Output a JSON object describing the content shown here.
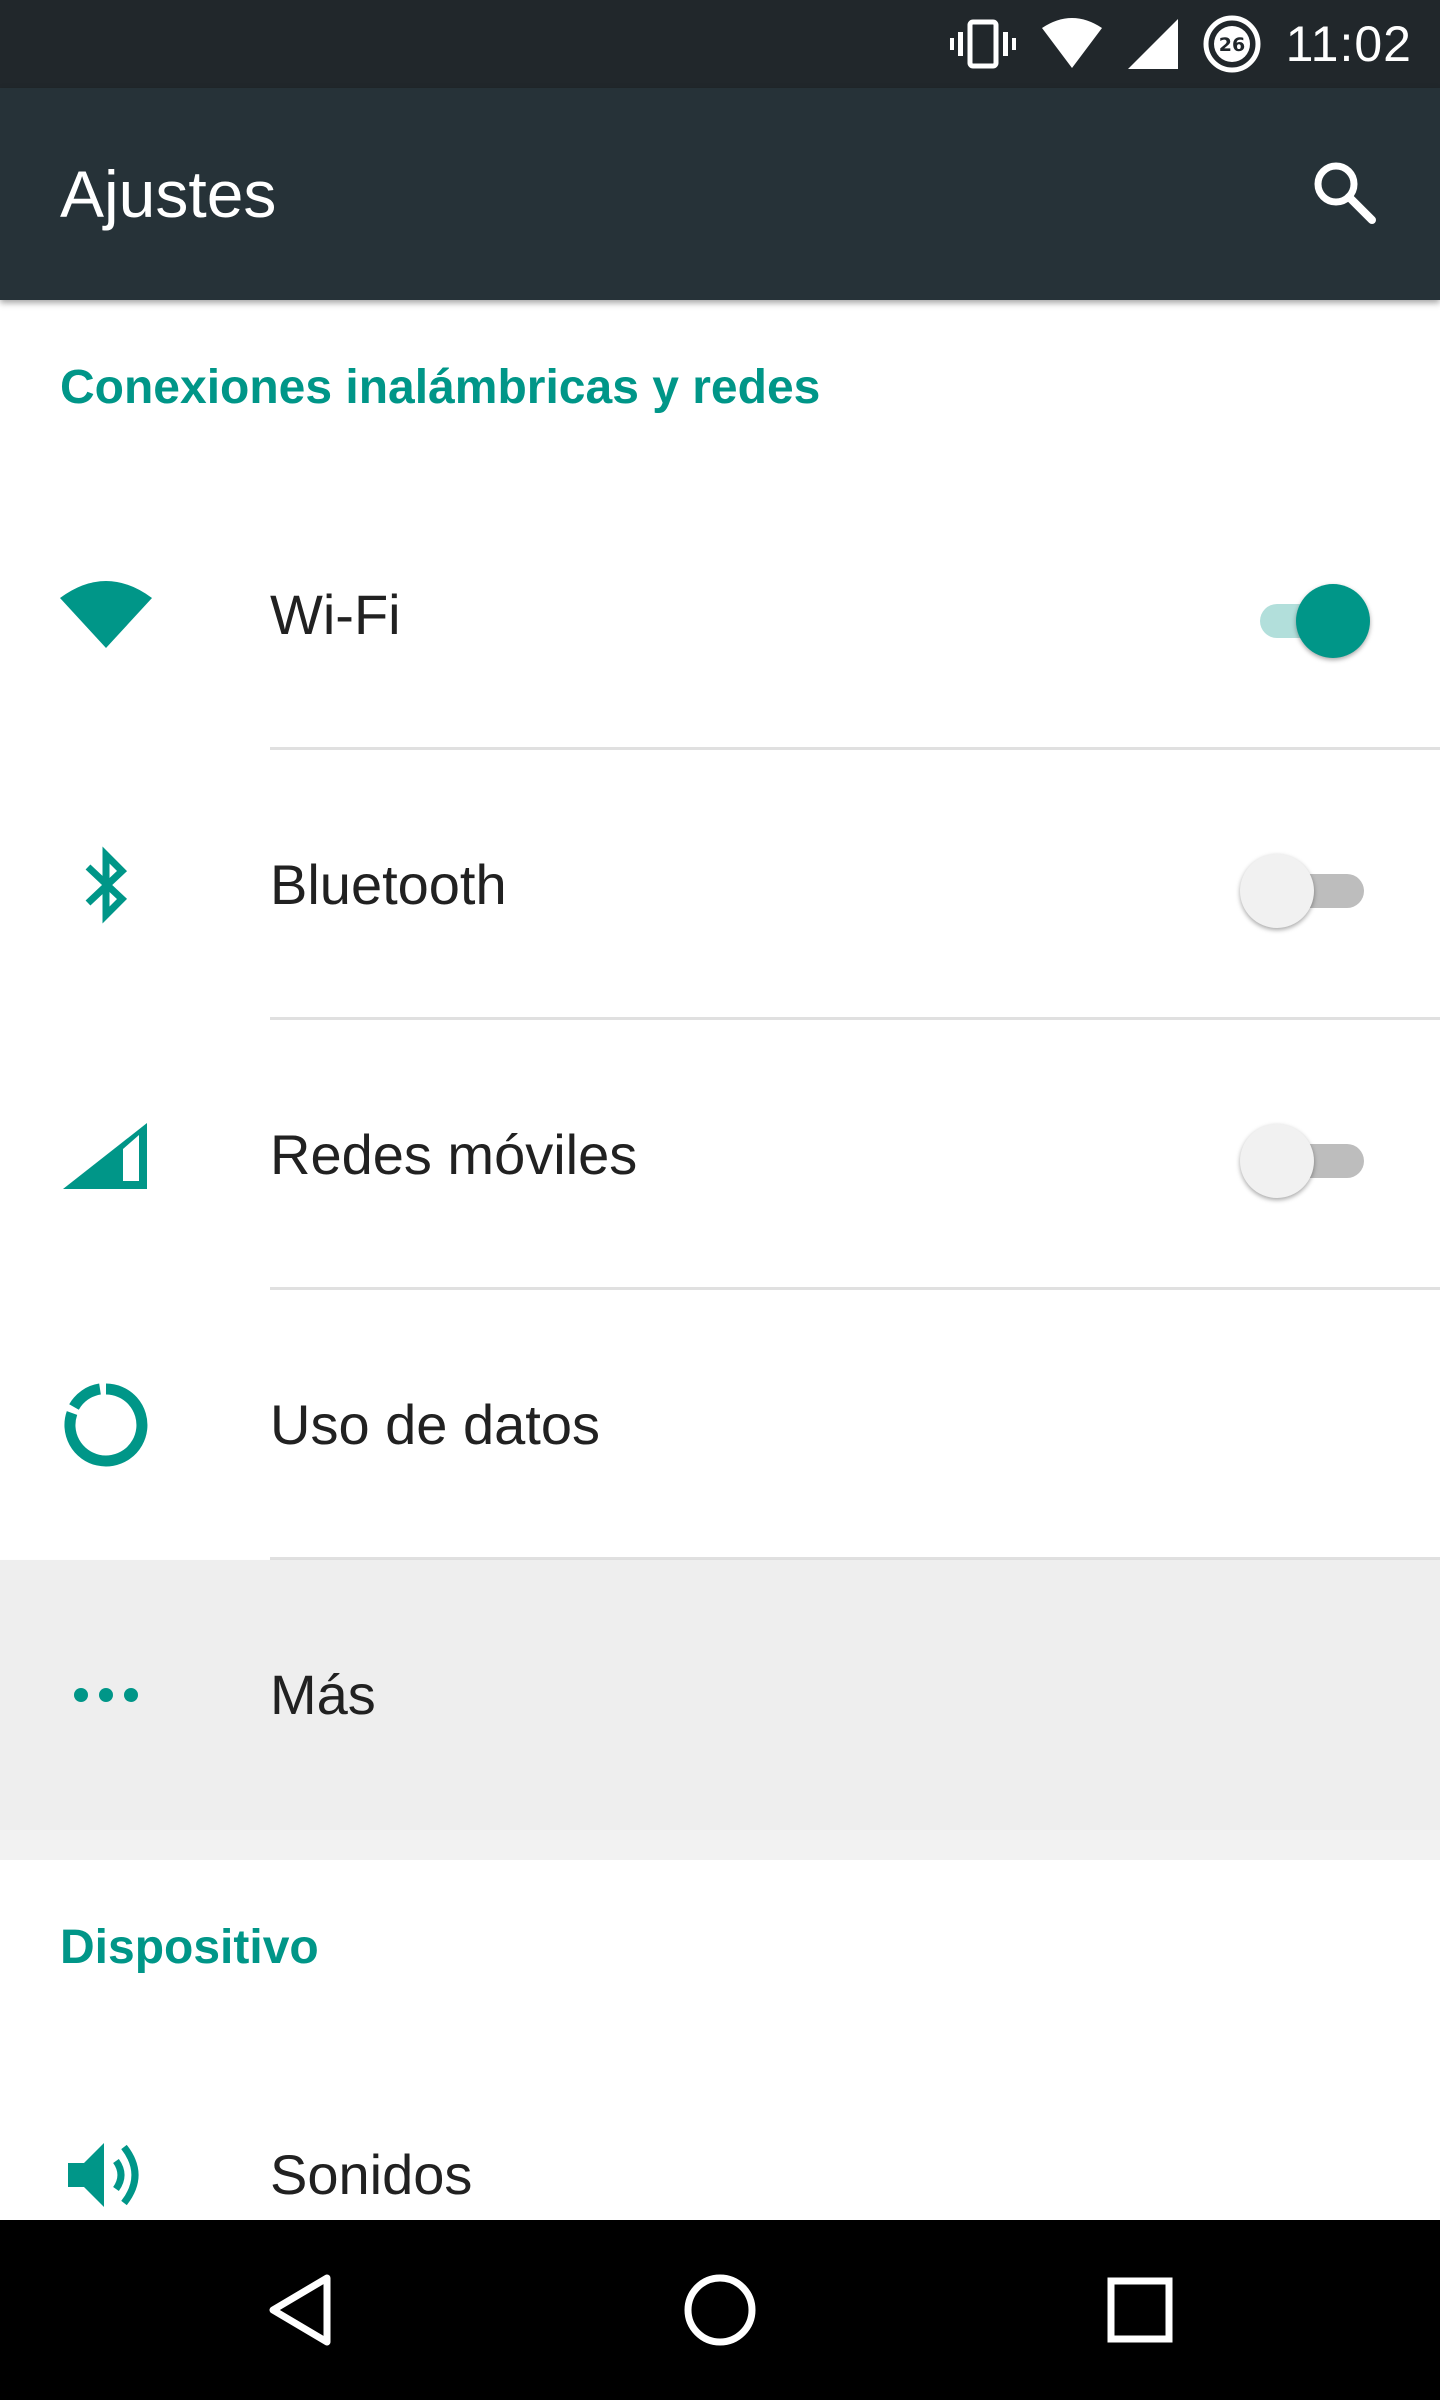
{
  "status_bar": {
    "time": "11:02",
    "badge": "26",
    "icons": [
      "vibrate-icon",
      "wifi-signal-icon",
      "cell-signal-icon",
      "data-saver-badge-icon"
    ]
  },
  "toolbar": {
    "title": "Ajustes",
    "search_icon": "search-icon"
  },
  "sections": [
    {
      "header": "Conexiones inalámbricas y redes",
      "items": [
        {
          "label": "Wi-Fi",
          "icon": "wifi-icon",
          "toggle": true
        },
        {
          "label": "Bluetooth",
          "icon": "bluetooth-icon",
          "toggle": false
        },
        {
          "label": "Redes móviles",
          "icon": "cell-signal-icon",
          "toggle": false
        },
        {
          "label": "Uso de datos",
          "icon": "data-usage-icon"
        },
        {
          "label": "Más",
          "icon": "more-icon",
          "pressed": true
        }
      ]
    },
    {
      "header": "Dispositivo",
      "items": [
        {
          "label": "Sonidos",
          "icon": "volume-icon"
        }
      ]
    }
  ],
  "nav_bar": {
    "buttons": [
      "back-icon",
      "home-icon",
      "recents-icon"
    ]
  },
  "colors": {
    "accent": "#009688",
    "toolbar": "#263238",
    "status_bar": "#21272b"
  }
}
